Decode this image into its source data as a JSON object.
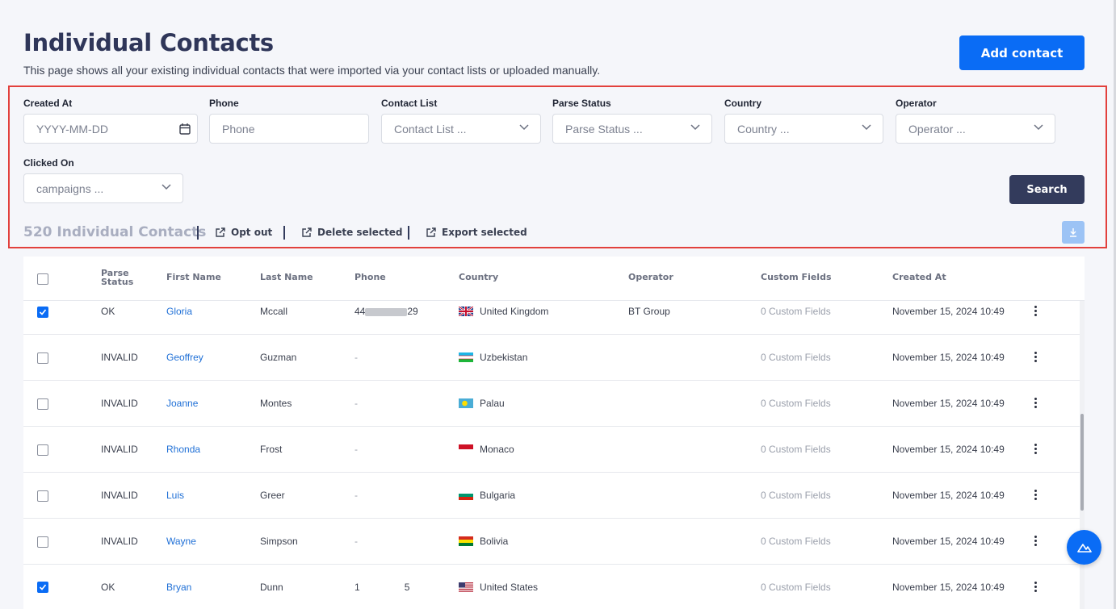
{
  "header": {
    "title": "Individual Contacts",
    "subtitle": "This page shows all your existing individual contacts that were imported via your contact lists or uploaded manually.",
    "add_button": "Add contact"
  },
  "filters": {
    "created_at": {
      "label": "Created At",
      "placeholder": "YYYY-MM-DD"
    },
    "phone": {
      "label": "Phone",
      "placeholder": "Phone"
    },
    "contact_list": {
      "label": "Contact List",
      "value": "Contact List ..."
    },
    "parse_status": {
      "label": "Parse Status",
      "value": "Parse Status ..."
    },
    "country": {
      "label": "Country",
      "value": "Country ..."
    },
    "operator": {
      "label": "Operator",
      "value": "Operator ..."
    },
    "clicked_on": {
      "label": "Clicked On",
      "value": "campaigns ..."
    },
    "search_button": "Search"
  },
  "toolbar": {
    "count": "520 Individual Contacts",
    "opt_out": "Opt out",
    "delete_selected": "Delete selected",
    "export_selected": "Export selected"
  },
  "table": {
    "columns": [
      "Parse Status",
      "First Name",
      "Last Name",
      "Phone",
      "Country",
      "Operator",
      "Custom Fields",
      "Created At"
    ],
    "rows": [
      {
        "checked": true,
        "status": "OK",
        "first": "Gloria",
        "last": "Mccall",
        "phone_prefix": "44",
        "phone_suffix": "29",
        "country": "United Kingdom",
        "flag": "uk",
        "operator": "BT Group",
        "custom": "0 Custom Fields",
        "created": "November 15, 2024 10:49"
      },
      {
        "checked": false,
        "status": "INVALID",
        "first": "Geoffrey",
        "last": "Guzman",
        "phone": "-",
        "country": "Uzbekistan",
        "flag": "uz",
        "operator": "",
        "custom": "0 Custom Fields",
        "created": "November 15, 2024 10:49"
      },
      {
        "checked": false,
        "status": "INVALID",
        "first": "Joanne",
        "last": "Montes",
        "phone": "-",
        "country": "Palau",
        "flag": "pw",
        "operator": "",
        "custom": "0 Custom Fields",
        "created": "November 15, 2024 10:49"
      },
      {
        "checked": false,
        "status": "INVALID",
        "first": "Rhonda",
        "last": "Frost",
        "phone": "-",
        "country": "Monaco",
        "flag": "mc",
        "operator": "",
        "custom": "0 Custom Fields",
        "created": "November 15, 2024 10:49"
      },
      {
        "checked": false,
        "status": "INVALID",
        "first": "Luis",
        "last": "Greer",
        "phone": "-",
        "country": "Bulgaria",
        "flag": "bg",
        "operator": "",
        "custom": "0 Custom Fields",
        "created": "November 15, 2024 10:49"
      },
      {
        "checked": false,
        "status": "INVALID",
        "first": "Wayne",
        "last": "Simpson",
        "phone": "-",
        "country": "Bolivia",
        "flag": "bo",
        "operator": "",
        "custom": "0 Custom Fields",
        "created": "November 15, 2024 10:49"
      },
      {
        "checked": true,
        "status": "OK",
        "first": "Bryan",
        "last": "Dunn",
        "phone_prefix": "1",
        "phone_suffix": "5",
        "country": "United States",
        "flag": "us",
        "operator": "",
        "custom": "0 Custom Fields",
        "created": "November 15, 2024 10:49"
      }
    ]
  },
  "colors": {
    "primary": "#0a6cf5",
    "dark_button": "#333b5c",
    "highlight_border": "#e2403c",
    "link": "#1e6fd6"
  },
  "icons": [
    "calendar-icon",
    "chevron-down-icon",
    "export-icon",
    "download-icon",
    "kebab-menu-icon",
    "check-icon",
    "chat-widget-icon"
  ]
}
